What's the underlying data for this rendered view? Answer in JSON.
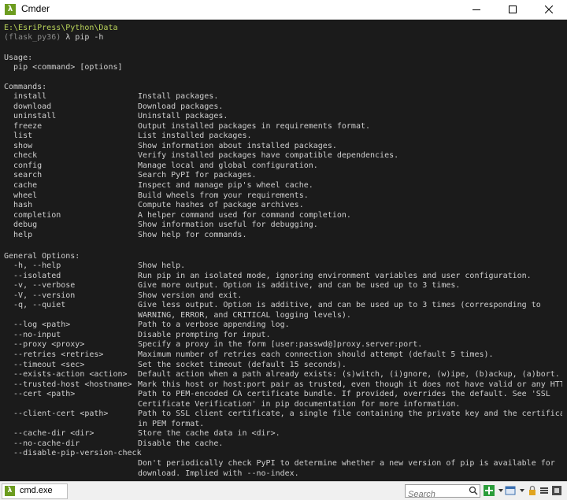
{
  "window": {
    "title": "Cmder",
    "app_icon_glyph": "λ"
  },
  "terminal": {
    "path_line": "E:\\EsriPress\\Python\\Data",
    "prompt_env": "(flask_py36)",
    "prompt_cmd": " λ pip -h",
    "usage_header": "Usage:",
    "usage_line": "  pip <command> [options]",
    "commands_header": "Commands:",
    "commands": [
      {
        "name": "  install",
        "desc": "Install packages."
      },
      {
        "name": "  download",
        "desc": "Download packages."
      },
      {
        "name": "  uninstall",
        "desc": "Uninstall packages."
      },
      {
        "name": "  freeze",
        "desc": "Output installed packages in requirements format."
      },
      {
        "name": "  list",
        "desc": "List installed packages."
      },
      {
        "name": "  show",
        "desc": "Show information about installed packages."
      },
      {
        "name": "  check",
        "desc": "Verify installed packages have compatible dependencies."
      },
      {
        "name": "  config",
        "desc": "Manage local and global configuration."
      },
      {
        "name": "  search",
        "desc": "Search PyPI for packages."
      },
      {
        "name": "  cache",
        "desc": "Inspect and manage pip's wheel cache."
      },
      {
        "name": "  wheel",
        "desc": "Build wheels from your requirements."
      },
      {
        "name": "  hash",
        "desc": "Compute hashes of package archives."
      },
      {
        "name": "  completion",
        "desc": "A helper command used for command completion."
      },
      {
        "name": "  debug",
        "desc": "Show information useful for debugging."
      },
      {
        "name": "  help",
        "desc": "Show help for commands."
      }
    ],
    "options_header": "General Options:",
    "options": [
      {
        "name": "  -h, --help",
        "desc": "Show help."
      },
      {
        "name": "  --isolated",
        "desc": "Run pip in an isolated mode, ignoring environment variables and user configuration."
      },
      {
        "name": "  -v, --verbose",
        "desc": "Give more output. Option is additive, and can be used up to 3 times."
      },
      {
        "name": "  -V, --version",
        "desc": "Show version and exit."
      },
      {
        "name": "  -q, --quiet",
        "desc": "Give less output. Option is additive, and can be used up to 3 times (corresponding to"
      },
      {
        "name": "",
        "desc": "WARNING, ERROR, and CRITICAL logging levels)."
      },
      {
        "name": "  --log <path>",
        "desc": "Path to a verbose appending log."
      },
      {
        "name": "  --no-input",
        "desc": "Disable prompting for input."
      },
      {
        "name": "  --proxy <proxy>",
        "desc": "Specify a proxy in the form [user:passwd@]proxy.server:port."
      },
      {
        "name": "  --retries <retries>",
        "desc": "Maximum number of retries each connection should attempt (default 5 times)."
      },
      {
        "name": "  --timeout <sec>",
        "desc": "Set the socket timeout (default 15 seconds)."
      },
      {
        "name": "  --exists-action <action>",
        "desc": "Default action when a path already exists: (s)witch, (i)gnore, (w)ipe, (b)ackup, (a)bort."
      },
      {
        "name": "  --trusted-host <hostname>",
        "desc": "Mark this host or host:port pair as trusted, even though it does not have valid or any HTTPS."
      },
      {
        "name": "  --cert <path>",
        "desc": "Path to PEM-encoded CA certificate bundle. If provided, overrides the default. See 'SSL"
      },
      {
        "name": "",
        "desc": "Certificate Verification' in pip documentation for more information."
      },
      {
        "name": "  --client-cert <path>",
        "desc": "Path to SSL client certificate, a single file containing the private key and the certificate"
      },
      {
        "name": "",
        "desc": "in PEM format."
      },
      {
        "name": "  --cache-dir <dir>",
        "desc": "Store the cache data in <dir>."
      },
      {
        "name": "  --no-cache-dir",
        "desc": "Disable the cache."
      },
      {
        "name": "  --disable-pip-version-check",
        "desc": ""
      },
      {
        "name": "",
        "desc": "Don't periodically check PyPI to determine whether a new version of pip is available for"
      },
      {
        "name": "",
        "desc": "download. Implied with --no-index."
      }
    ]
  },
  "statusbar": {
    "tab_label": "cmd.exe",
    "tab_icon_glyph": "λ",
    "search_placeholder": "Search"
  },
  "colors": {
    "path": "#b9d35a",
    "text": "#cfcfcf",
    "env": "#8a8a8a",
    "background": "#1b1b1b",
    "accent": "#6c9c1f"
  }
}
